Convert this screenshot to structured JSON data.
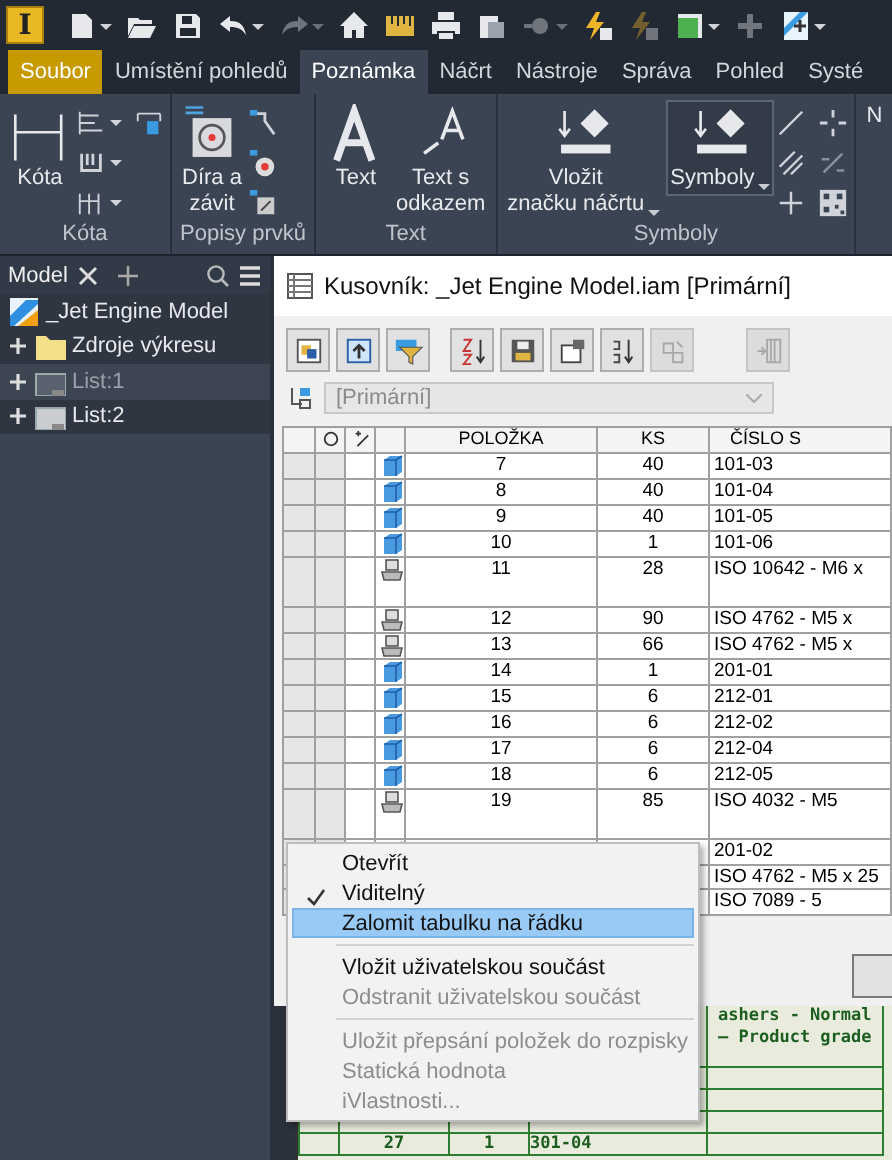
{
  "app": {
    "logo_letter": "I"
  },
  "quick_access": [
    {
      "kind": "new",
      "dropdown": true,
      "disabled": false
    },
    {
      "kind": "open",
      "dropdown": false,
      "disabled": false
    },
    {
      "kind": "save",
      "dropdown": false,
      "disabled": false
    },
    {
      "kind": "undo",
      "dropdown": true,
      "disabled": false
    },
    {
      "kind": "redo",
      "dropdown": true,
      "disabled": true
    },
    {
      "kind": "home",
      "dropdown": false,
      "disabled": false
    },
    {
      "kind": "ruler",
      "dropdown": false,
      "disabled": false
    },
    {
      "kind": "print",
      "dropdown": false,
      "disabled": false
    },
    {
      "kind": "clipboard",
      "dropdown": false,
      "disabled": false
    },
    {
      "kind": "dot",
      "dropdown": true,
      "disabled": true
    },
    {
      "kind": "bolt",
      "dropdown": false,
      "disabled": false
    },
    {
      "kind": "bolt",
      "dropdown": false,
      "disabled": true
    },
    {
      "kind": "cube",
      "dropdown": true,
      "disabled": false
    },
    {
      "kind": "plus",
      "dropdown": false,
      "disabled": true
    },
    {
      "kind": "doc",
      "dropdown": true,
      "disabled": false
    }
  ],
  "tabs": [
    {
      "label": "Soubor",
      "kind": "file",
      "selected": false
    },
    {
      "label": "Umístění pohledů",
      "kind": "tab",
      "selected": false
    },
    {
      "label": "Poznámka",
      "kind": "tab",
      "selected": true
    },
    {
      "label": "Náčrt",
      "kind": "tab",
      "selected": false
    },
    {
      "label": "Nástroje",
      "kind": "tab",
      "selected": false
    },
    {
      "label": "Správa",
      "kind": "tab",
      "selected": false
    },
    {
      "label": "Pohled",
      "kind": "tab",
      "selected": false
    },
    {
      "label": "Systé",
      "kind": "tab",
      "selected": false
    }
  ],
  "ribbon": {
    "groups": [
      {
        "label": "Kóta",
        "buttons": [
          {
            "label": "Kóta",
            "kind": "dimension",
            "dropdown": false,
            "selected": false
          }
        ],
        "tools": [
          {
            "kind": "baseline",
            "dropdown": true
          },
          {
            "kind": "ordinate",
            "dropdown": true
          },
          {
            "kind": "chain",
            "dropdown": true
          },
          {
            "kind": "retrieve",
            "dropdown": false
          }
        ]
      },
      {
        "label": "Popisy prvků",
        "buttons": [
          {
            "label": "Díra a\nzávit",
            "kind": "hole",
            "dropdown": false,
            "selected": false
          }
        ],
        "tools": [
          {
            "kind": "chamfer",
            "dropdown": false
          },
          {
            "kind": "punch",
            "dropdown": false
          },
          {
            "kind": "bend",
            "dropdown": false
          }
        ]
      },
      {
        "label": "Text",
        "buttons": [
          {
            "label": "Text",
            "kind": "text",
            "dropdown": false,
            "selected": false
          },
          {
            "label": "Text s\nodkazem",
            "kind": "leader",
            "dropdown": false,
            "selected": false
          }
        ]
      },
      {
        "label": "Symboly",
        "buttons": [
          {
            "label": "Vložit\nznačku náčrtu",
            "kind": "symbol",
            "dropdown": true,
            "selected": false
          },
          {
            "label": "Symboly",
            "kind": "symbol",
            "dropdown": true,
            "selected": true
          }
        ],
        "tools": [
          {
            "kind": "line",
            "dropdown": false
          },
          {
            "kind": "hatch",
            "dropdown": false
          },
          {
            "kind": "cross",
            "dropdown": false
          },
          {
            "kind": "cross4",
            "dropdown": false
          },
          {
            "kind": "slash",
            "dropdown": false
          },
          {
            "kind": "qr",
            "dropdown": false
          }
        ]
      },
      {
        "buttons": [
          {
            "label": "N",
            "kind": "cut",
            "dropdown": false,
            "selected": false
          }
        ]
      }
    ]
  },
  "browser": {
    "tab": "Model",
    "tree": [
      {
        "label": "_Jet Engine Model",
        "kind": "assembly",
        "selected": false,
        "children": [
          {
            "label": "Zdroje výkresu",
            "kind": "folder",
            "expanded": false,
            "selected": false
          },
          {
            "label": "List:1",
            "kind": "sheet",
            "expanded": false,
            "selected": true
          },
          {
            "label": "List:2",
            "kind": "sheet",
            "expanded": false,
            "selected": false
          }
        ]
      }
    ]
  },
  "dialog": {
    "title": "Kusovník: _Jet Engine Model.iam [Primární]",
    "toolbar": [
      {
        "kind": "view",
        "disabled": false
      },
      {
        "kind": "export",
        "disabled": false
      },
      {
        "kind": "filter",
        "disabled": false
      },
      {
        "kind": "sort",
        "disabled": false
      },
      {
        "kind": "save",
        "disabled": false
      },
      {
        "kind": "props",
        "disabled": false
      },
      {
        "kind": "renumber",
        "disabled": false
      },
      {
        "kind": "merge",
        "disabled": true
      },
      {
        "kind": "columns",
        "disabled": true
      }
    ],
    "view_select": {
      "value": "[Primární]",
      "disabled": true
    },
    "table": {
      "columns": [
        "POLOŽKA",
        "KS",
        "ČÍSLO S"
      ],
      "rows": [
        {
          "kind": "part",
          "tall": false,
          "item": "7",
          "qty": "40",
          "part": "101-03"
        },
        {
          "kind": "part",
          "tall": false,
          "item": "8",
          "qty": "40",
          "part": "101-04"
        },
        {
          "kind": "part",
          "tall": false,
          "item": "9",
          "qty": "40",
          "part": "101-05"
        },
        {
          "kind": "part",
          "tall": false,
          "item": "10",
          "qty": "1",
          "part": "101-06"
        },
        {
          "kind": "cc",
          "tall": true,
          "item": "11",
          "qty": "28",
          "part": "ISO 10642 - M6 x"
        },
        {
          "kind": "cc",
          "tall": false,
          "item": "12",
          "qty": "90",
          "part": "ISO 4762 - M5 x"
        },
        {
          "kind": "cc",
          "tall": false,
          "item": "13",
          "qty": "66",
          "part": "ISO 4762 - M5 x"
        },
        {
          "kind": "part",
          "tall": false,
          "item": "14",
          "qty": "1",
          "part": "201-01"
        },
        {
          "kind": "part",
          "tall": false,
          "item": "15",
          "qty": "6",
          "part": "212-01"
        },
        {
          "kind": "part",
          "tall": false,
          "item": "16",
          "qty": "6",
          "part": "212-02"
        },
        {
          "kind": "part",
          "tall": false,
          "item": "17",
          "qty": "6",
          "part": "212-04"
        },
        {
          "kind": "part",
          "tall": false,
          "item": "18",
          "qty": "6",
          "part": "212-05"
        },
        {
          "kind": "cc",
          "tall": true,
          "item": "19",
          "qty": "85",
          "part": "ISO 4032 - M5"
        },
        {
          "kind": "part",
          "tall": false,
          "part": "201-02"
        },
        {
          "tall": false,
          "part": "ISO 4762 - M5 x 25"
        },
        {
          "tall": false,
          "part": "ISO 7089 - 5"
        }
      ]
    }
  },
  "drawing": {
    "description_lines": [
      "ashers - Normal",
      "– Product grade"
    ],
    "bottom_row": {
      "item": "27",
      "qty": "1",
      "part": "301-04"
    }
  },
  "context_menu": [
    {
      "kind": "item",
      "label": "Otevřít",
      "checked": false,
      "disabled": false,
      "selected": false
    },
    {
      "kind": "item",
      "label": "Viditelný",
      "checked": true,
      "disabled": false,
      "selected": false
    },
    {
      "kind": "item",
      "label": "Zalomit tabulku na řádku",
      "checked": false,
      "disabled": false,
      "selected": true
    },
    {
      "kind": "separator"
    },
    {
      "kind": "item",
      "label": "Vložit uživatelskou součást",
      "checked": false,
      "disabled": false,
      "selected": false
    },
    {
      "kind": "item",
      "label": "Odstranit uživatelskou součást",
      "checked": false,
      "disabled": true,
      "selected": false
    },
    {
      "kind": "separator"
    },
    {
      "kind": "item",
      "label": "Uložit přepsání položek do rozpisky",
      "checked": false,
      "disabled": true,
      "selected": false
    },
    {
      "kind": "item",
      "label": "Statická hodnota",
      "checked": false,
      "disabled": true,
      "selected": false
    },
    {
      "kind": "item",
      "label": "iVlastnosti...",
      "checked": false,
      "disabled": true,
      "selected": false
    }
  ]
}
